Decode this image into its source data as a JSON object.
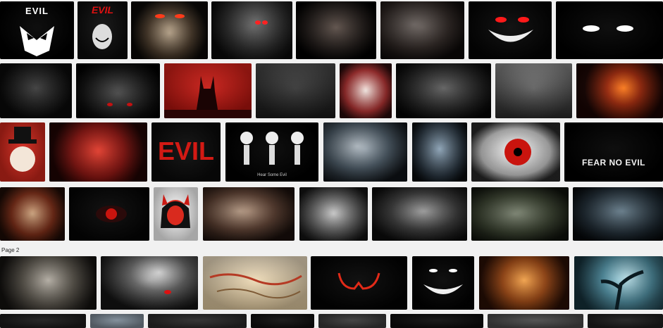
{
  "page_label": "Page 2",
  "tile_texts": {
    "evil_logo": "EVIL",
    "evil_red_hand": "EVIL",
    "evil_big": "EVIL",
    "hear_some_evil": "Hear Some Evil",
    "fear_no_evil": "FEAR NO EVIL"
  },
  "colors": {
    "page_bg": "#f1f1f1",
    "accent_red": "#cc1a14"
  }
}
